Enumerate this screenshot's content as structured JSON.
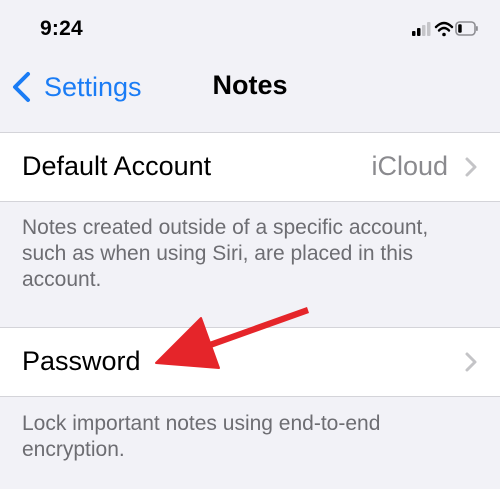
{
  "status_bar": {
    "time": "9:24",
    "icons": [
      "cellular-signal-icon",
      "wifi-icon",
      "battery-icon"
    ]
  },
  "nav": {
    "back_label": "Settings",
    "title": "Notes"
  },
  "rows": [
    {
      "label": "Default Account",
      "value": "iCloud"
    },
    {
      "label": "Password",
      "value": ""
    }
  ],
  "footers": [
    "Notes created outside of a specific account, such as when using Siri, are placed in this account.",
    "Lock important notes using end-to-end encryption."
  ],
  "colors": {
    "accent": "#1a7cf5",
    "background": "#f2f2f7",
    "annotation_arrow": "#e5252a"
  }
}
